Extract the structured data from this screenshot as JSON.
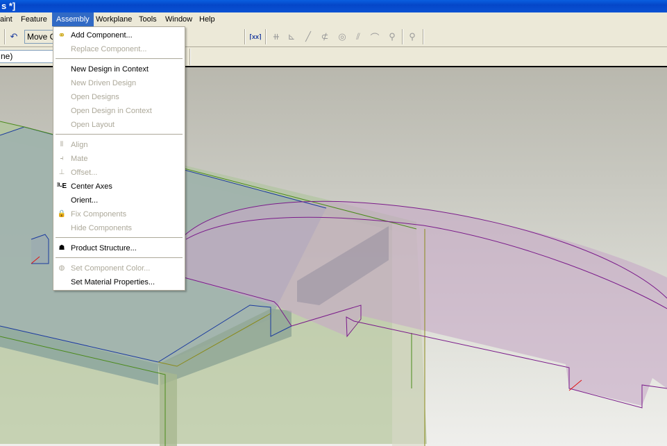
{
  "window": {
    "title_fragment": "s *]"
  },
  "menubar": {
    "items": [
      {
        "label": "aint",
        "active": false
      },
      {
        "label": "Feature",
        "active": false
      },
      {
        "label": "Assembly",
        "active": true
      },
      {
        "label": "Workplane",
        "active": false
      },
      {
        "label": "Tools",
        "active": false
      },
      {
        "label": "Window",
        "active": false
      },
      {
        "label": "Help",
        "active": false
      }
    ]
  },
  "toolbar": {
    "move_button_label": "Move C",
    "selection_combo_value": "ne)",
    "icons": [
      "undo-icon",
      "dimension-icon",
      "parallel-constraint-icon",
      "perpendicular-constraint-icon",
      "line-icon",
      "tangent-icon",
      "concentric-icon",
      "equal-icon",
      "curve-constraint-icon",
      "fix-constraint-icon",
      "zoom-icon"
    ]
  },
  "assembly_menu": {
    "items": [
      {
        "label": "Add Component...",
        "disabled": false,
        "icon": "add-component-icon"
      },
      {
        "label": "Replace Component...",
        "disabled": true,
        "icon": ""
      },
      {
        "type": "divider"
      },
      {
        "label": "New Design in Context",
        "disabled": false,
        "icon": ""
      },
      {
        "label": "New Driven Design",
        "disabled": true,
        "icon": ""
      },
      {
        "label": "Open Designs",
        "disabled": true,
        "icon": ""
      },
      {
        "label": "Open Design in Context",
        "disabled": true,
        "icon": ""
      },
      {
        "label": "Open Layout",
        "disabled": true,
        "icon": ""
      },
      {
        "type": "divider"
      },
      {
        "label": "Align",
        "disabled": true,
        "icon": "align-icon"
      },
      {
        "label": "Mate",
        "disabled": true,
        "icon": "mate-icon"
      },
      {
        "label": "Offset...",
        "disabled": true,
        "icon": "offset-icon"
      },
      {
        "label": "Center Axes",
        "disabled": false,
        "icon": "center-axes-icon"
      },
      {
        "label": "Orient...",
        "disabled": false,
        "icon": ""
      },
      {
        "label": "Fix Components",
        "disabled": true,
        "icon": "fix-components-icon"
      },
      {
        "label": "Hide Components",
        "disabled": true,
        "icon": ""
      },
      {
        "type": "divider"
      },
      {
        "label": "Product Structure...",
        "disabled": false,
        "icon": "product-structure-icon"
      },
      {
        "type": "divider"
      },
      {
        "label": "Set Component Color...",
        "disabled": true,
        "icon": "component-color-icon"
      },
      {
        "label": "Set Material Properties...",
        "disabled": false,
        "icon": ""
      }
    ]
  },
  "colors": {
    "title_bar": "#0a52d4",
    "menu_highlight": "#316ac5",
    "disabled_text": "#aca899",
    "edge_blue": "#1a3a9e",
    "edge_green": "#4a8a1a",
    "edge_purple": "#7a1a8a",
    "edge_olive": "#8a8a1a"
  }
}
